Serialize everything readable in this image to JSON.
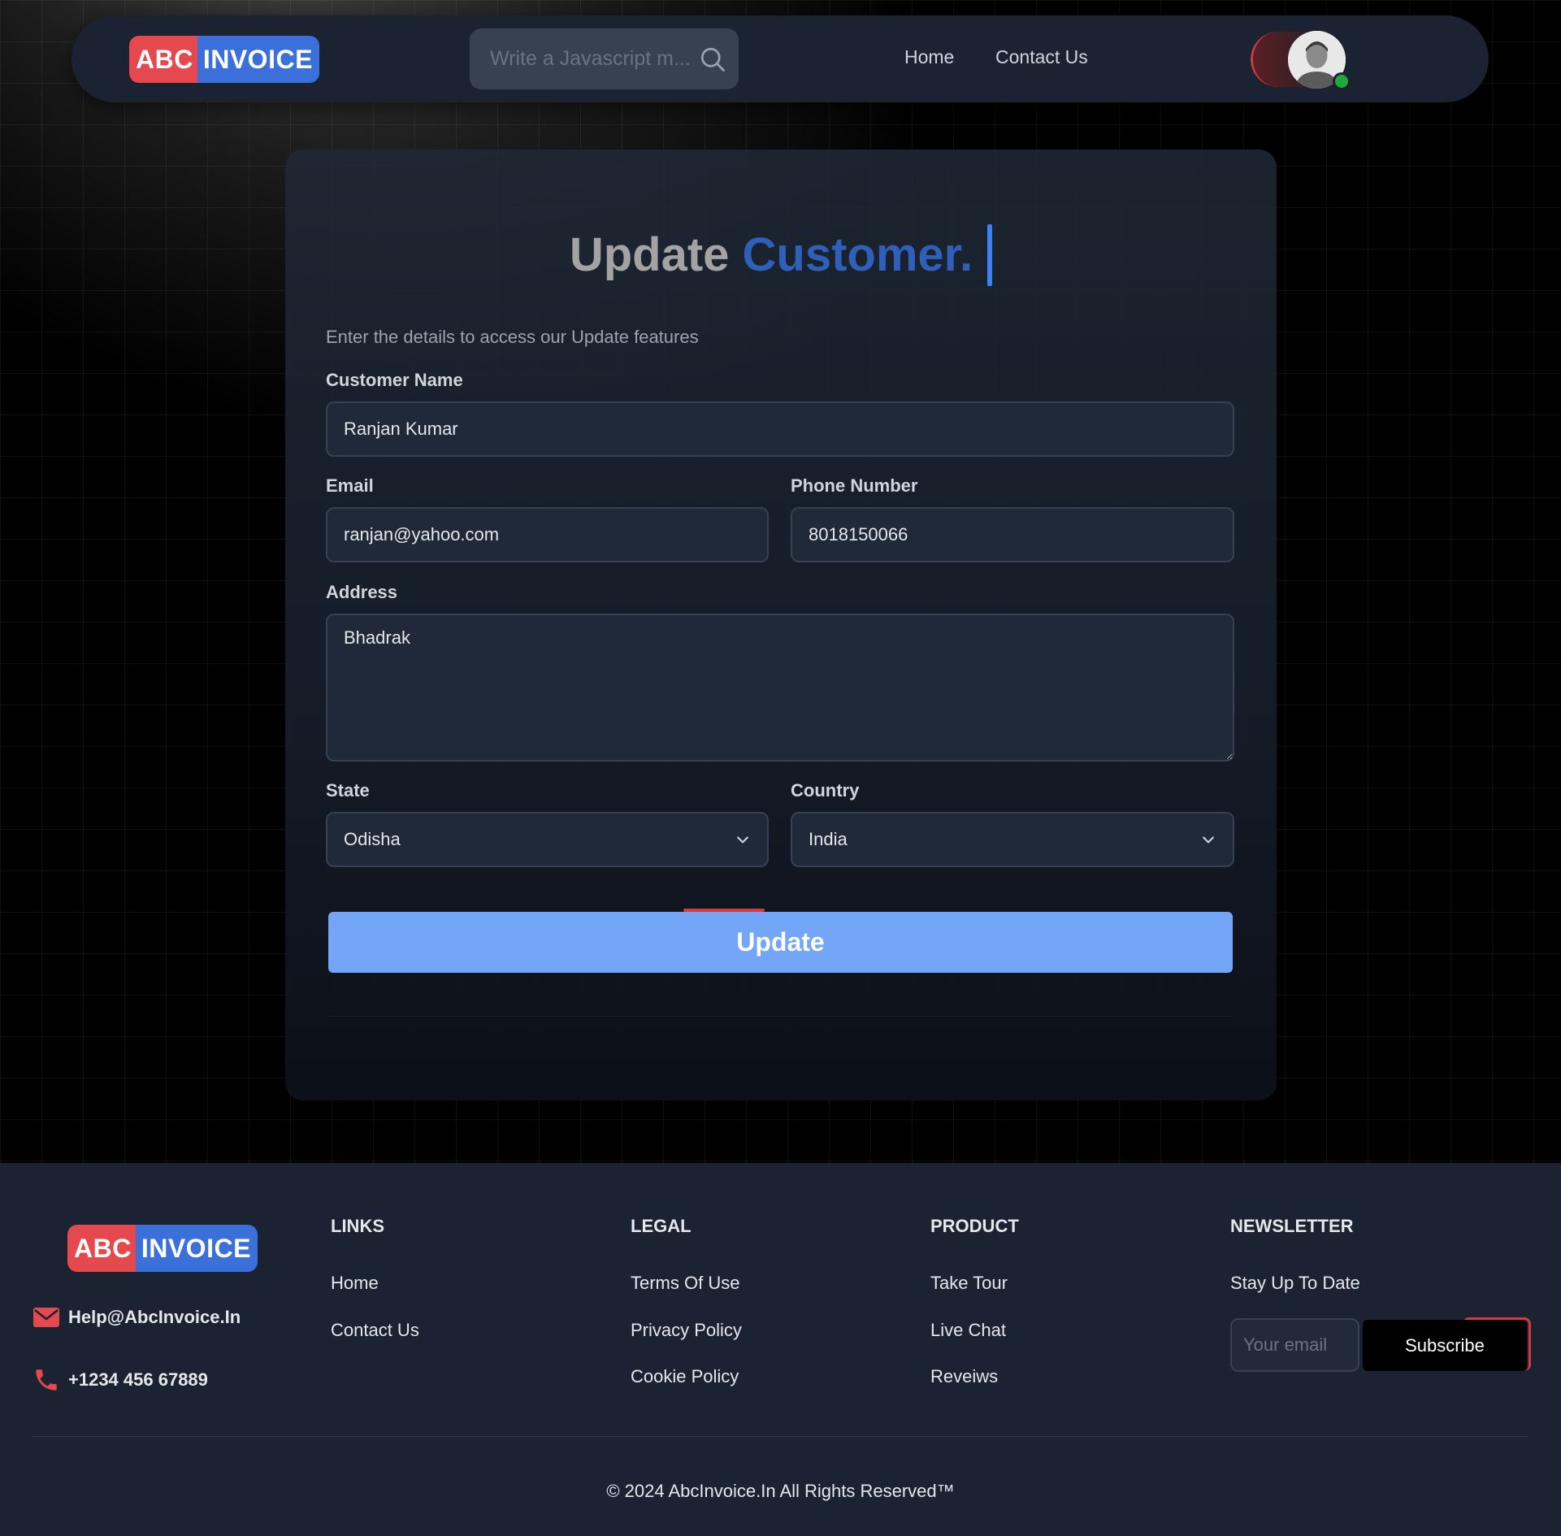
{
  "brand": {
    "part1": "ABC",
    "part2": "INVOICE"
  },
  "navbar": {
    "search_placeholder": "Write a Javascript m...",
    "links": [
      "Home",
      "Contact Us"
    ],
    "theme": "dark"
  },
  "form": {
    "title_word1": "Update",
    "title_word2": "Customer.",
    "subtitle": "Enter the details to access our Update features",
    "customer_name": {
      "label": "Customer Name",
      "value": "Ranjan Kumar"
    },
    "email": {
      "label": "Email",
      "value": "ranjan@yahoo.com"
    },
    "phone": {
      "label": "Phone Number",
      "value": "8018150066"
    },
    "address": {
      "label": "Address",
      "value": "Bhadrak"
    },
    "state": {
      "label": "State",
      "value": "Odisha"
    },
    "country": {
      "label": "Country",
      "value": "India"
    },
    "submit_label": "Update"
  },
  "footer": {
    "email": "Help@AbcInvoice.In",
    "phone": "+1234 456 67889",
    "columns": [
      {
        "heading": "LINKS",
        "items": [
          "Home",
          "Contact Us"
        ]
      },
      {
        "heading": "LEGAL",
        "items": [
          "Terms Of Use",
          "Privacy Policy",
          "Cookie Policy"
        ]
      },
      {
        "heading": "PRODUCT",
        "items": [
          "Take Tour",
          "Live Chat",
          "Reveiws"
        ]
      }
    ],
    "newsletter": {
      "heading": "NEWSLETTER",
      "tagline": "Stay Up To Date",
      "email_placeholder": "Your email",
      "button_label": "Subscribe"
    },
    "copyright": "© 2024 AbcInvoice.In All Rights Reserved™"
  },
  "colors": {
    "brand_red": "#e5484d",
    "brand_blue": "#3b6fd9",
    "accent_blue": "#74a6f8",
    "status_online": "#22a83a"
  }
}
